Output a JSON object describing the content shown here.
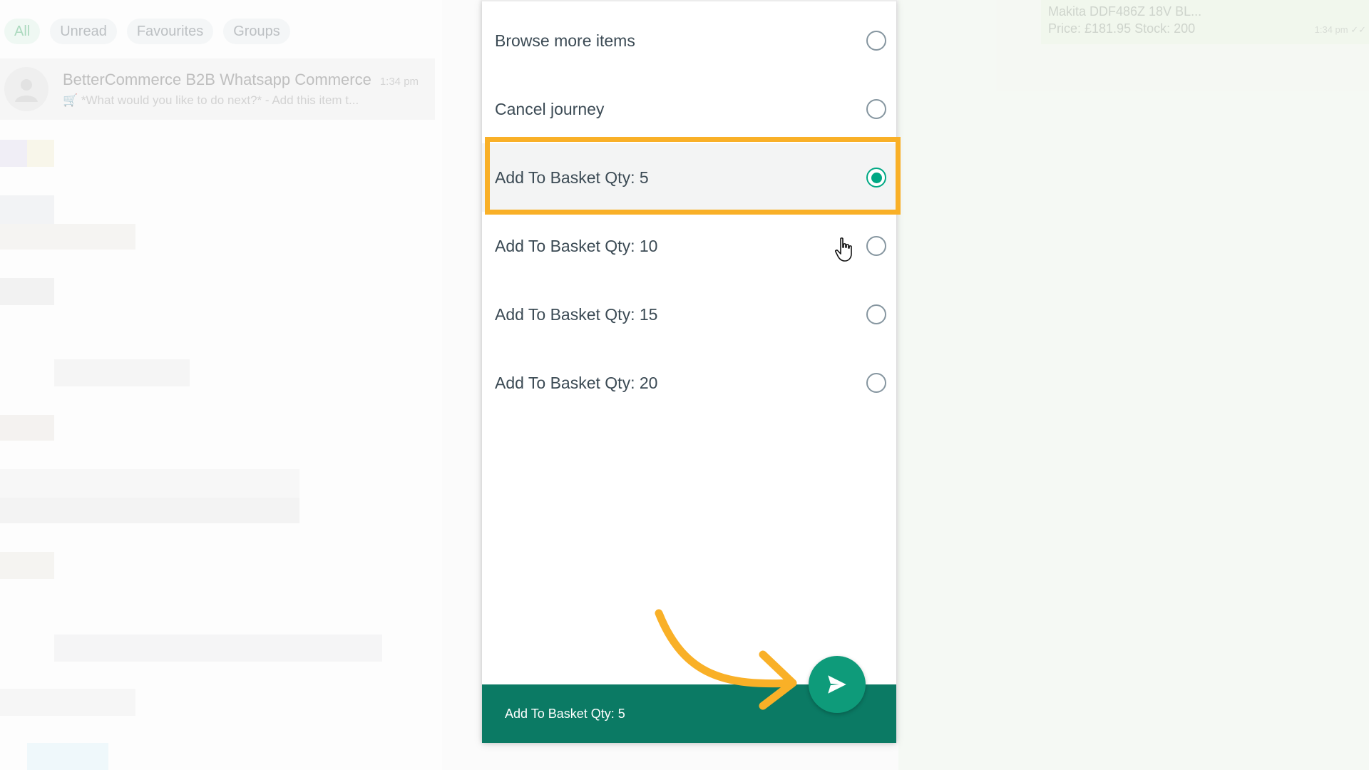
{
  "chat_list": {
    "filters": [
      "All",
      "Unread",
      "Favourites",
      "Groups"
    ],
    "active_filter": "All",
    "chat": {
      "name": "BetterCommerce B2B Whatsapp Commerce",
      "time": "1:34 pm",
      "preview": "🛒 *What would you like to do next?*   - Add this item t..."
    }
  },
  "conversation": {
    "message_line1": "Makita DDF486Z 18V BL...",
    "message_line2": "Price: £181.95   Stock: 200",
    "message_time": "1:34 pm ✓✓"
  },
  "list_panel": {
    "options": [
      {
        "label": "Browse more items",
        "checked": false
      },
      {
        "label": "Cancel journey",
        "checked": false
      },
      {
        "label": "Add To Basket Qty: 5",
        "checked": true
      },
      {
        "label": "Add To Basket Qty: 10",
        "checked": false
      },
      {
        "label": "Add To Basket Qty: 15",
        "checked": false
      },
      {
        "label": "Add To Basket Qty: 20",
        "checked": false
      }
    ],
    "selected_text": "Add To Basket Qty: 5"
  },
  "colors": {
    "accent": "#00a884",
    "footer": "#0b7a64",
    "send_button": "#0e9b7a",
    "annotation": "#f9b027"
  },
  "icons": {
    "send": "send-icon",
    "radio": "radio-icon",
    "cursor": "hand-cursor-icon",
    "avatar": "default-avatar-icon"
  }
}
